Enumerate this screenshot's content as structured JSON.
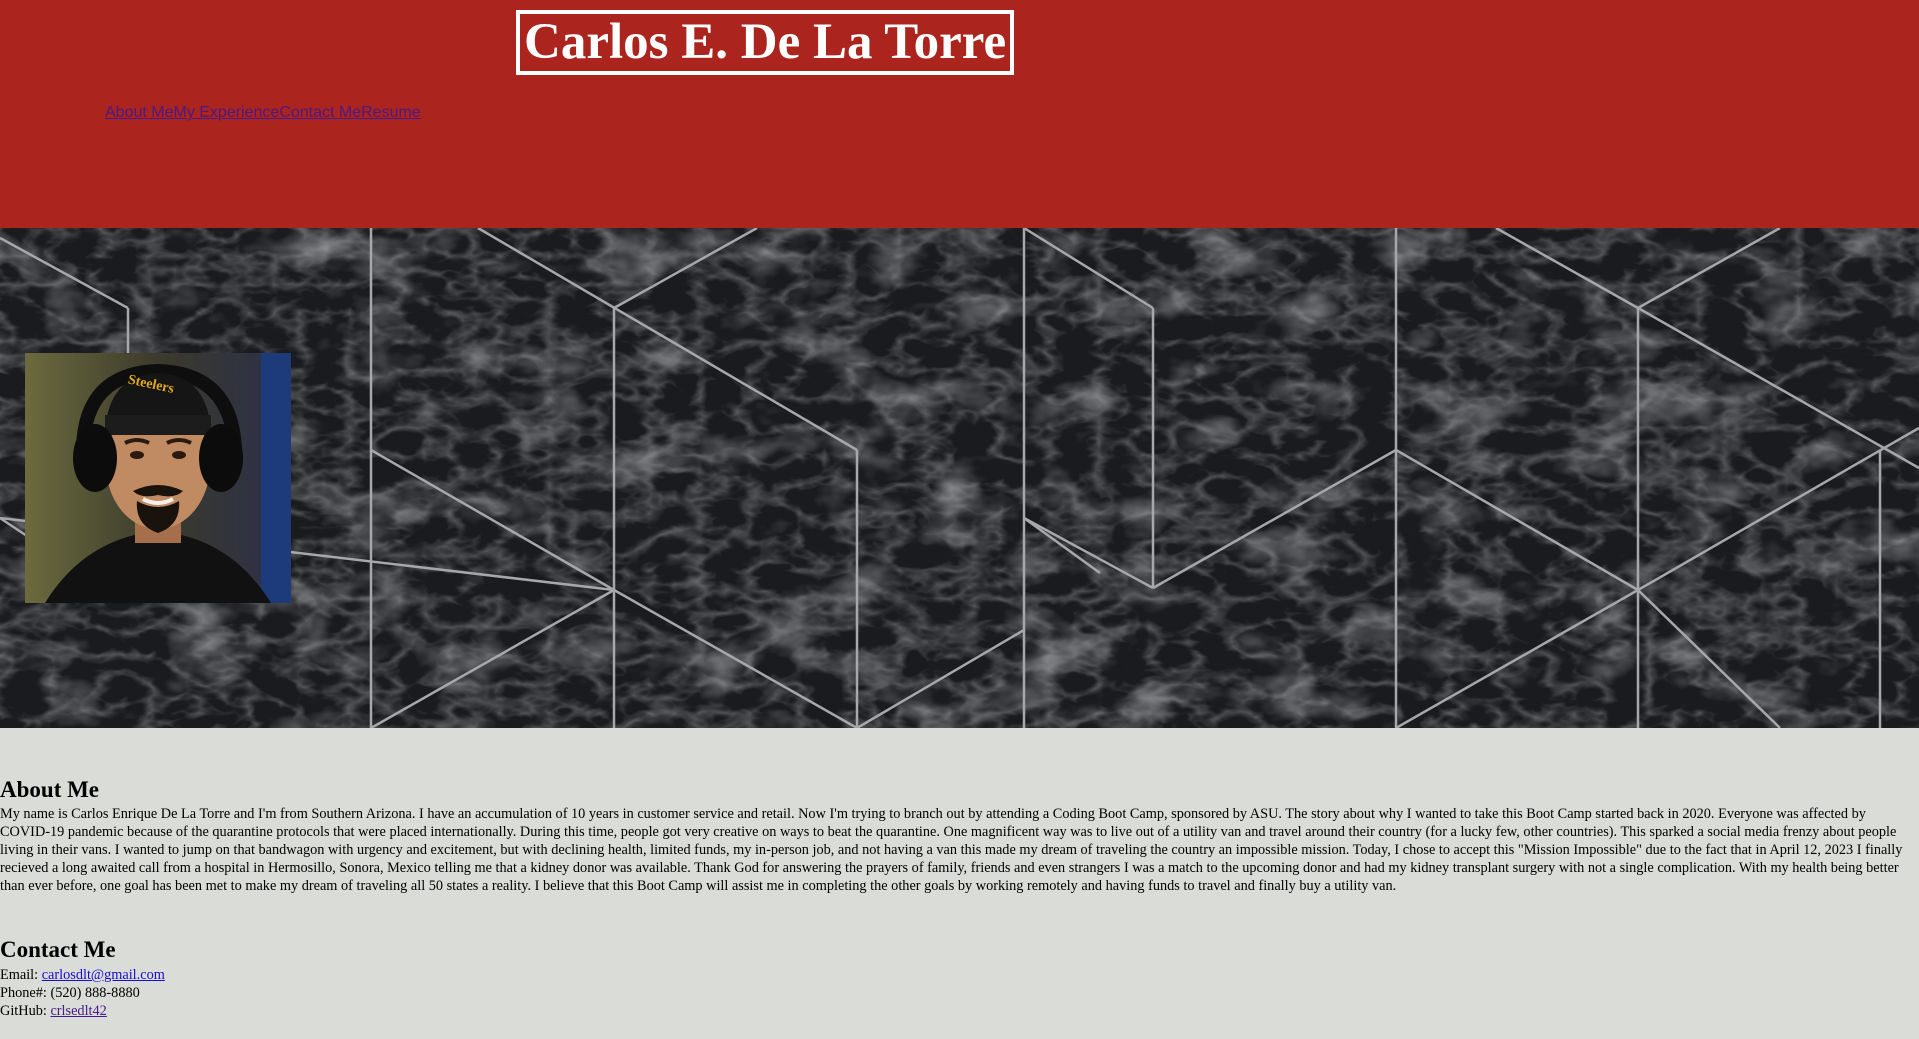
{
  "header": {
    "title": "Carlos E. De La Torre",
    "nav": [
      {
        "label": "About Me"
      },
      {
        "label": "My Experience"
      },
      {
        "label": "Contact Me"
      },
      {
        "label": "Resume"
      }
    ],
    "background_color": "#ab241d"
  },
  "hero": {
    "background_color": "#1a1b1e",
    "profile_icon": "profile-photo-icon"
  },
  "about": {
    "heading": "About Me",
    "body": "My name is Carlos Enrique De La Torre and I'm from Southern Arizona. I have an accumulation of 10 years in customer service and retail. Now I'm trying to branch out by attending a Coding Boot Camp, sponsored by ASU. The story about why I wanted to take this Boot Camp started back in 2020. Everyone was affected by COVID-19 pandemic because of the quarantine protocols that were placed internationally. During this time, people got very creative on ways to beat the quarantine. One magnificent way was to live out of a utility van and travel around their country (for a lucky few, other countries). This sparked a social media frenzy about people living in their vans. I wanted to jump on that bandwagon with urgency and excitement, but with declining health, limited funds, my in-person job, and not having a van this made my dream of traveling the country an impossible mission. Today, I chose to accept this \"Mission Impossible\" due to the fact that in April 12, 2023 I finally recieved a long awaited call from a hospital in Hermosillo, Sonora, Mexico telling me that a kidney donor was available. Thank God for answering the prayers of family, friends and even strangers I was a match to the upcoming donor and had my kidney transplant surgery with not a single complication. With my health being better than ever before, one goal has been met to make my dream of traveling all 50 states a reality. I believe that this Boot Camp will assist me in completing the other goals by working remotely and having funds to travel and finally buy a utility van."
  },
  "contact": {
    "heading": "Contact Me",
    "email_label": "Email: ",
    "email": "carlosdlt@gmail.com",
    "phone_label": "Phone#: ",
    "phone": "(520) 888-8880",
    "github_label": "GitHub: ",
    "github": "crlsedlt42"
  },
  "colors": {
    "page_background": "#d9dcd7",
    "link_visited": "#4a1a86",
    "link": "#1a0dcc"
  }
}
